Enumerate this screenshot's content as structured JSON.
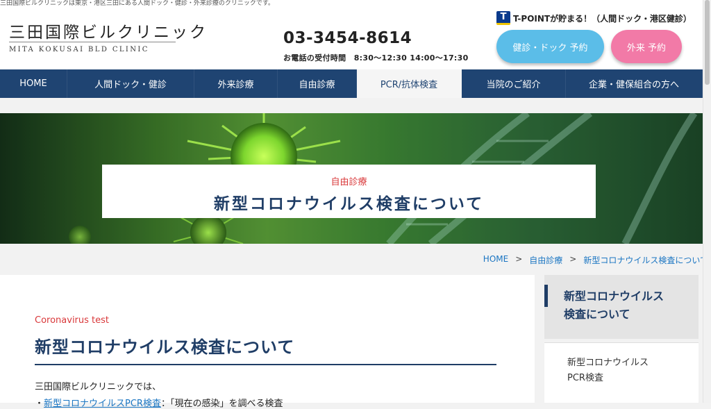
{
  "top_strip": "三田国際ビルクリニックは東京・港区三田にある人間ドック・健診・外来診療のクリニックです。",
  "logo": {
    "ja": "三田国際ビルクリニック",
    "en": "MITA KOKUSAI BLD CLINIC"
  },
  "contact": {
    "phone": "03-3454-8614",
    "hours": "お電話の受付時間　8:30〜12:30 14:00〜17:30"
  },
  "tpoint": {
    "logo": "T",
    "text": "T-POINTが貯まる！（人間ドック・港区健診）"
  },
  "buttons": {
    "checkup": "健診・ドック 予約",
    "outpatient": "外来 予約"
  },
  "nav": [
    {
      "label": "HOME",
      "width": 97
    },
    {
      "label": "人間ドック・健診",
      "width": 183
    },
    {
      "label": "外来診療",
      "width": 120
    },
    {
      "label": "自由診療",
      "width": 114
    },
    {
      "label": "PCR/抗体検査",
      "width": 151,
      "active": true
    },
    {
      "label": "当院のご紹介",
      "width": 150
    },
    {
      "label": "企業・健保組合の方へ",
      "width": 197
    }
  ],
  "hero": {
    "subtitle": "自由診療",
    "title": "新型コロナウイルス検査について"
  },
  "breadcrumb": {
    "home": "HOME",
    "sep": ">",
    "parent": "自由診療",
    "current": "新型コロナウイルス検査について"
  },
  "main": {
    "en_label": "Coronavirus test",
    "title": "新型コロナウイルス検査について",
    "intro": "三田国際ビルクリニックでは、",
    "bullet_prefix": "・",
    "bullet_link": "新型コロナウイルスPCR検査",
    "bullet_rest": "：「現在の感染」を調べる検査"
  },
  "sidebar": {
    "heading": "新型コロナウイルス検査について",
    "heading_line1": "新型コロナウイルス",
    "heading_line2": "検査について",
    "item_line1": "新型コロナウイルス",
    "item_line2": "PCR検査"
  },
  "colors": {
    "navy": "#1f4472",
    "accent_red": "#d9383a",
    "blue_button": "#5bbde8",
    "pink_button": "#f27aa7",
    "link": "#1a75c2"
  }
}
